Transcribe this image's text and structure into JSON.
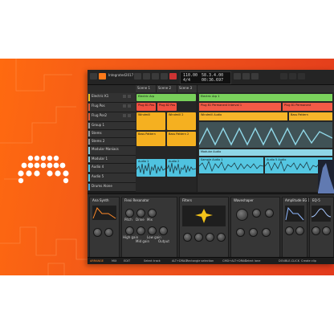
{
  "colors": {
    "banner_start": "#ff6a10",
    "banner_end": "#e23a1c",
    "daw_bg": "#1b1b1b",
    "accent": "#ff7a1a"
  },
  "logo": {
    "icon": "bitwig-logo-icon"
  },
  "toolbar": {
    "project_tab": "Integrated2017",
    "tempo": "110.00",
    "time_sig": "4/4",
    "position": "58.3.4.00",
    "time": "00:36.697"
  },
  "tracks": [
    {
      "name": "Electric K1",
      "color": "#f0c020"
    },
    {
      "name": "Flug Pos",
      "color": "#e05a30"
    },
    {
      "name": "Flug Pos2",
      "color": "#e05a30"
    },
    {
      "name": "Group 1",
      "color": "#9a9a9a"
    },
    {
      "name": "Stems",
      "color": "#9a9a9a"
    },
    {
      "name": "Stems 2",
      "color": "#9a9a9a"
    },
    {
      "name": "Modular Maniacs",
      "color": "#8bd0e0"
    },
    {
      "name": "Modular 1",
      "color": "#8bd0e0"
    },
    {
      "name": "Audio 4",
      "color": "#58c8e0"
    },
    {
      "name": "Audio 5",
      "color": "#58c8e0"
    },
    {
      "name": "Drums Alone",
      "color": "#4aa8d8"
    }
  ],
  "scenes": [
    "Scene 1",
    "Scene 2",
    "Scene 3"
  ],
  "clips": [
    {
      "label": "Electric Arp",
      "color": "#78d05a"
    },
    {
      "label": "Plug 81 Pos",
      "color": "#f05040"
    },
    {
      "label": "Plug 82 Pos",
      "color": "#f05040"
    },
    {
      "label": "Windmill",
      "color": "#f5b020"
    },
    {
      "label": "Windmill 2",
      "color": "#f5b020"
    },
    {
      "label": "Bass Pattern",
      "color": "#f5b020"
    },
    {
      "label": "Bass Pattern 2",
      "color": "#f5b020"
    },
    {
      "label": "Audio 1",
      "color": "#4fc3e0"
    },
    {
      "label": "Audio 2",
      "color": "#4fc3e0"
    }
  ],
  "arranger": [
    {
      "label": "Electric Arp 1",
      "color": "#7ad25c"
    },
    {
      "label": "Plug 81 Permanent Interval 1",
      "color": "#f25a46"
    },
    {
      "label": "Plug 81 Permanent",
      "color": "#f25a46"
    },
    {
      "label": "Windmill Audio",
      "color": "#f7b52a"
    },
    {
      "label": "Bass Pattern",
      "color": "#f7b52a"
    },
    {
      "label": "Modular Audio",
      "color": "#8fd6e6"
    },
    {
      "label": "Sample Audio 1",
      "color": "#55c7e2"
    },
    {
      "label": "Audio 5 Audio",
      "color": "#55c7e2"
    }
  ],
  "devices": [
    {
      "title": "Ana Synth"
    },
    {
      "title": "Flexi Resonator"
    },
    {
      "title": "Filters"
    },
    {
      "title": "Waveshaper"
    },
    {
      "title": "Amplitude EG 1"
    },
    {
      "title": "EQ-5"
    }
  ],
  "knob_labels": [
    "Pitch",
    "Drive",
    "Mix",
    "High gain",
    "Mid gain",
    "Low gain",
    "Output"
  ],
  "status": [
    {
      "text": "ARRANGE"
    },
    {
      "text": "MIX"
    },
    {
      "text": "EDIT"
    },
    {
      "text": "Select track"
    },
    {
      "text": "ALT+DRAG"
    },
    {
      "text": "Rectangle selection"
    },
    {
      "text": "CMD+ALT+DRAG"
    },
    {
      "text": "Select lane"
    },
    {
      "text": "DOUBLE-CLICK"
    },
    {
      "text": "Create clip"
    }
  ]
}
